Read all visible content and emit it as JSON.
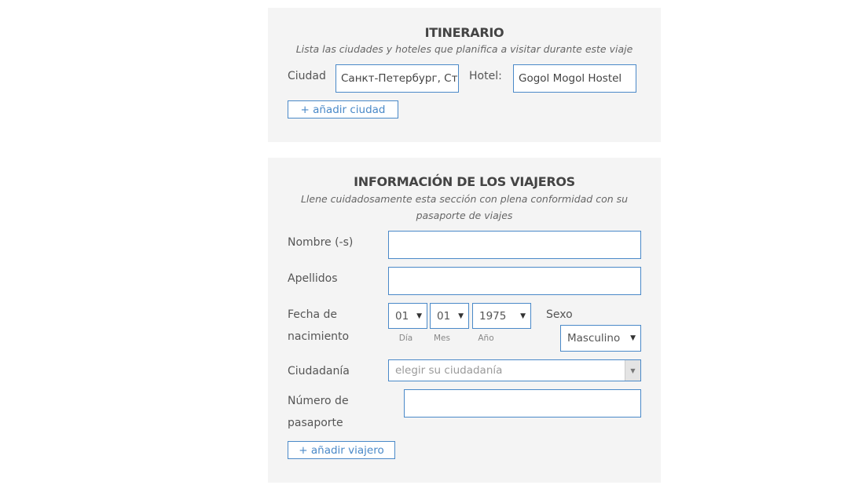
{
  "itinerary": {
    "title": "ITINERARIO",
    "subtitle": "Lista las ciudades y hoteles que planifica a visitar durante este viaje",
    "city_label": "Ciudad",
    "city_value": "Санкт-Петербург, Ста",
    "hotel_label": "Hotel:",
    "hotel_value": "Gogol Mogol Hostel",
    "add_city_label": "+ añadir ciudad"
  },
  "travelers": {
    "title": "INFORMACIÓN DE LOS VIAJEROS",
    "subtitle_line1": "Llene cuidadosamente esta sección con plena conformidad con su",
    "subtitle_line2": "pasaporte de viajes",
    "name_label": "Nombre (-s)",
    "name_value": "",
    "surname_label": "Apellidos",
    "surname_value": "",
    "birth_label_line1": "Fecha de",
    "birth_label_line2": "nacimiento",
    "day_value": "01",
    "day_caption": "Día",
    "month_value": "01",
    "month_caption": "Mes",
    "year_value": "1975",
    "year_caption": "Año",
    "sex_label": "Sexo",
    "sex_value": "Masculino",
    "citizenship_label": "Ciudadanía",
    "citizenship_placeholder": "elegir su ciudadanía",
    "passport_label_line1": "Número de",
    "passport_label_line2": "pasaporte",
    "passport_value": "",
    "add_traveler_label": "+ añadir viajero"
  },
  "icons": {
    "dropdown_arrow": "▼"
  }
}
